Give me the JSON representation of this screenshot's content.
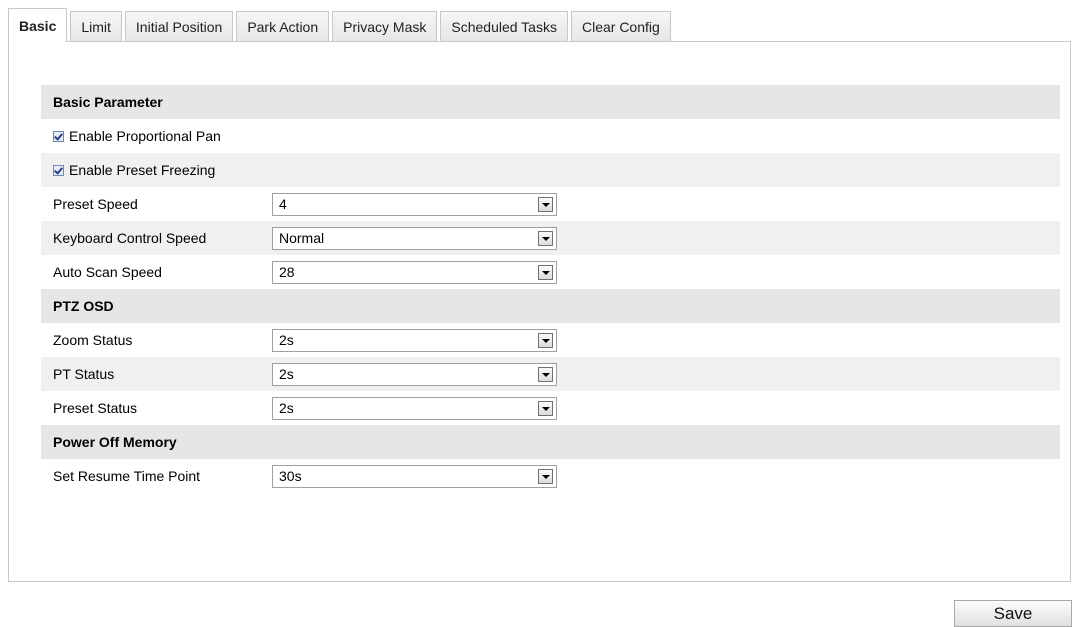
{
  "tabs": [
    "Basic",
    "Limit",
    "Initial Position",
    "Park Action",
    "Privacy Mask",
    "Scheduled Tasks",
    "Clear Config"
  ],
  "active_tab": "Basic",
  "basic_parameter": {
    "title": "Basic Parameter",
    "enable_proportional_pan": {
      "label": "Enable Proportional Pan",
      "checked": true
    },
    "enable_preset_freezing": {
      "label": "Enable Preset Freezing",
      "checked": true
    },
    "preset_speed": {
      "label": "Preset Speed",
      "value": "4"
    },
    "keyboard_control_speed": {
      "label": "Keyboard Control Speed",
      "value": "Normal"
    },
    "auto_scan_speed": {
      "label": "Auto Scan Speed",
      "value": "28"
    }
  },
  "ptz_osd": {
    "title": "PTZ OSD",
    "zoom_status": {
      "label": "Zoom Status",
      "value": "2s"
    },
    "pt_status": {
      "label": "PT Status",
      "value": "2s"
    },
    "preset_status": {
      "label": "Preset Status",
      "value": "2s"
    }
  },
  "power_off_memory": {
    "title": "Power Off Memory",
    "set_resume_time_point": {
      "label": "Set Resume Time Point",
      "value": "30s"
    }
  },
  "save_label": "Save"
}
